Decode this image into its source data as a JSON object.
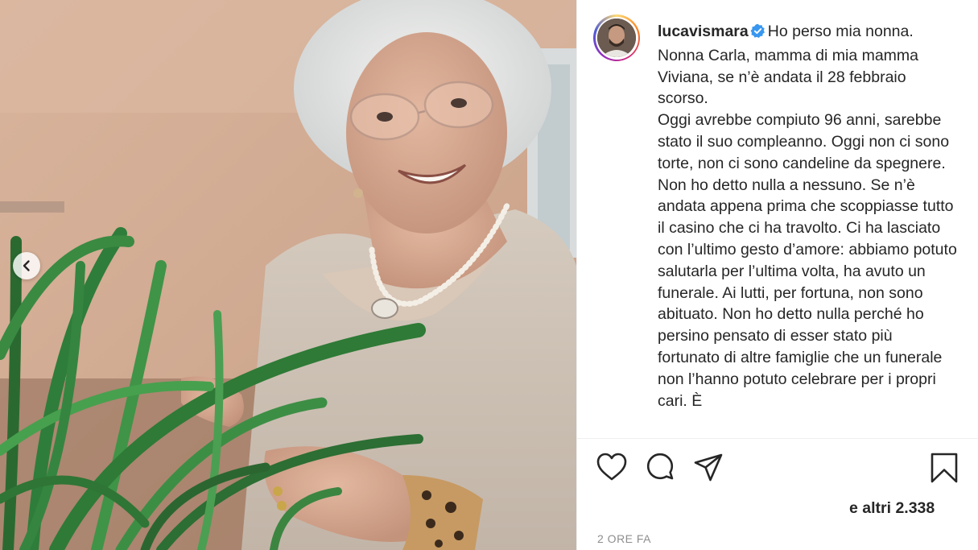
{
  "post": {
    "username": "lucavismara",
    "verified": true,
    "caption_lines": [
      "Ho perso mia nonna.",
      "Nonna Carla, mamma di mia mamma Viviana, se n’è andata il 28 febbraio scorso.",
      "Oggi avrebbe compiuto 96 anni, sarebbe stato il suo compleanno. Oggi non ci sono torte, non ci sono candeline da spegnere.",
      "Non ho detto nulla a nessuno. Se n’è andata appena prima che scoppiasse tutto il casino che ci ha travolto. Ci ha lasciato con l’ultimo gesto d’amore: abbiamo potuto salutarla per l’ultima volta, ha avuto un funerale. Ai lutti, per fortuna, non sono abituato. Non ho detto nulla perché ho persino pensato di esser stato più fortunato di altre famiglie che un funerale non l’hanno potuto celebrare per i propri cari. È"
    ],
    "likes_text": "e altri 2.338",
    "timestamp": "2 ORE FA"
  },
  "icons": {
    "prev": "chevron-left-icon",
    "like": "heart-icon",
    "comment": "comment-icon",
    "share": "paper-plane-icon",
    "save": "bookmark-icon",
    "verified": "verified-badge-icon"
  },
  "colors": {
    "text": "#262626",
    "muted": "#8e8e8e",
    "verified": "#3897f0",
    "divider": "#efefef"
  }
}
